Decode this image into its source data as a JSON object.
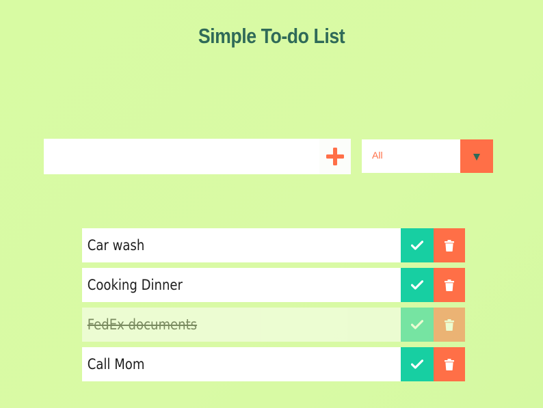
{
  "header": {
    "title": "Simple To-do List"
  },
  "add_form": {
    "input_value": "",
    "input_placeholder": "",
    "add_icon": "plus-icon",
    "accent_color": "#ff6f47"
  },
  "filter": {
    "selected": "All",
    "arrow_icon": "caret-down-icon"
  },
  "todos": [
    {
      "text": "Car wash",
      "completed": false
    },
    {
      "text": "Cooking Dinner",
      "completed": false
    },
    {
      "text": "FedEx documents",
      "completed": true
    },
    {
      "text": "Call Mom",
      "completed": false
    }
  ],
  "icons": {
    "complete": "check-icon",
    "delete": "trash-icon"
  },
  "colors": {
    "background": "#d8fba3",
    "title": "#2f6a58",
    "complete_button": "#17cfa2",
    "delete_button": "#ff6f47"
  }
}
